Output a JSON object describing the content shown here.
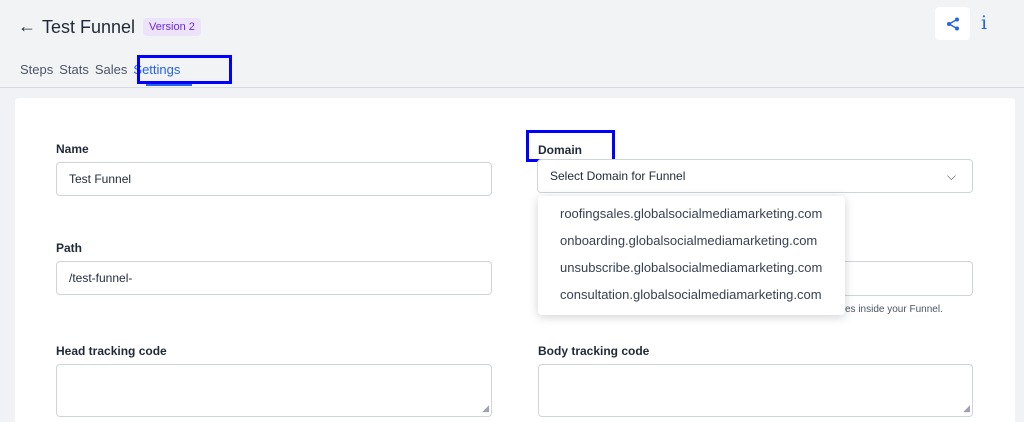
{
  "header": {
    "back_icon": "arrow-left-icon",
    "title": "Test Funnel",
    "version_badge": "Version 2",
    "share_icon": "share-icon",
    "info_icon": "info-icon",
    "colors": {
      "accent": "#2563eb",
      "badge_bg": "#ece3fb",
      "badge_text": "#6d28d9",
      "highlight": "#0000ff"
    }
  },
  "tabs": [
    {
      "label": "Steps",
      "active": false
    },
    {
      "label": "Stats",
      "active": false
    },
    {
      "label": "Sales",
      "active": false
    },
    {
      "label": "Settings",
      "active": true
    }
  ],
  "form": {
    "name": {
      "label": "Name",
      "value": "Test Funnel"
    },
    "domain": {
      "label": "Domain",
      "placeholder": "Select Domain for Funnel",
      "options": [
        "roofingsales.globalsocialmediamarketing.com",
        "onboarding.globalsocialmediamarketing.com",
        "unsubscribe.globalsocialmediamarketing.com",
        "consultation.globalsocialmediamarketing.com"
      ]
    },
    "path": {
      "label": "Path",
      "value": "/test-funnel-"
    },
    "partial_help_text": "es inside your Funnel.",
    "head_tracking": {
      "label": "Head tracking code",
      "value": ""
    },
    "body_tracking": {
      "label": "Body tracking code",
      "value": ""
    }
  }
}
